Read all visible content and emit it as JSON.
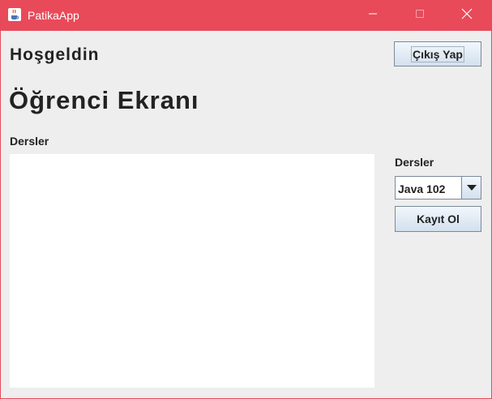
{
  "window": {
    "title": "PatikaApp",
    "icon": "java-cup-icon",
    "titlebar_color": "#e84a5a"
  },
  "header": {
    "welcome": "Hoşgeldin",
    "logout_label": "Çıkış Yap"
  },
  "main": {
    "screen_title": "Öğrenci Ekranı",
    "list_label": "Dersler"
  },
  "side": {
    "course_label": "Dersler",
    "selected_course": "Java 102",
    "enroll_label": "Kayıt Ol"
  }
}
